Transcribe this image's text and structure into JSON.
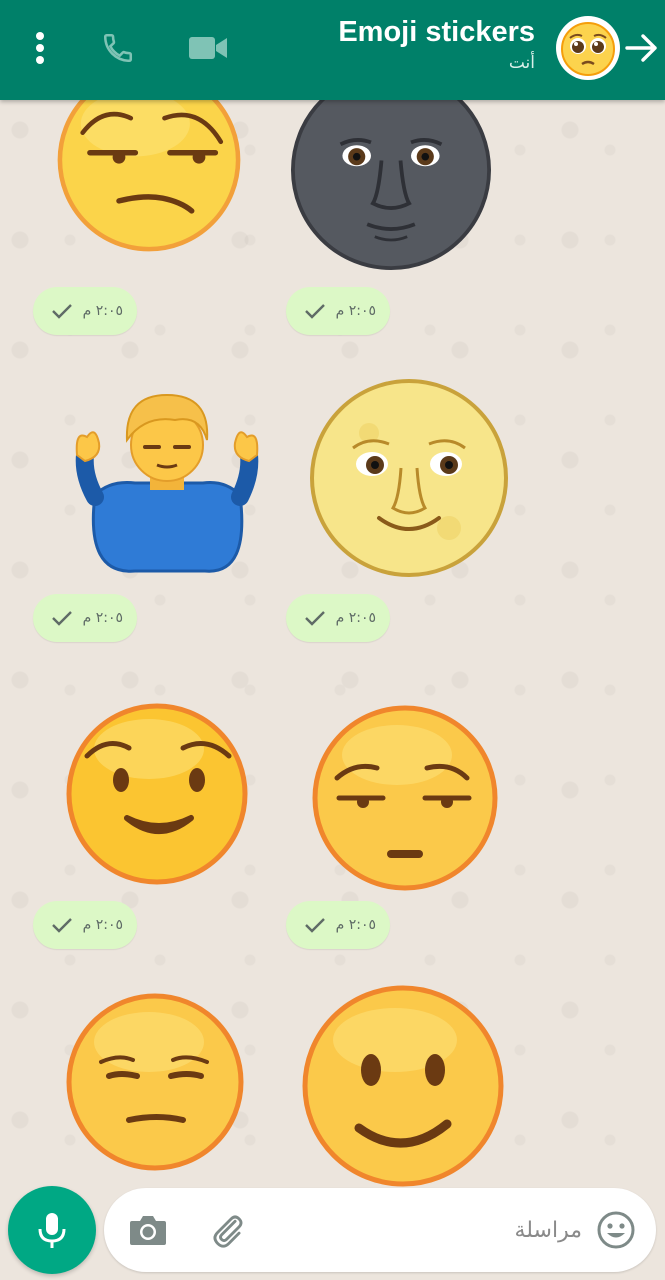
{
  "header": {
    "title": "Emoji stickers",
    "subtitle": "أنت",
    "color": "#008069"
  },
  "messages": [
    {
      "sticker": "unamused-face",
      "time": "٢:٠٥ م"
    },
    {
      "sticker": "new-moon-face",
      "time": "٢:٠٥ م"
    },
    {
      "sticker": "person-shrugging",
      "time": "٢:٠٥ م"
    },
    {
      "sticker": "full-moon-face",
      "time": "٢:٠٥ م"
    },
    {
      "sticker": "smiling-face",
      "time": "٢:٠٥ م"
    },
    {
      "sticker": "face-with-raised-eyebrows",
      "time": "٢:٠٥ م"
    },
    {
      "sticker": "expressionless-face"
    },
    {
      "sticker": "slightly-smiling-face"
    }
  ],
  "composer": {
    "placeholder": "مراسلة"
  }
}
